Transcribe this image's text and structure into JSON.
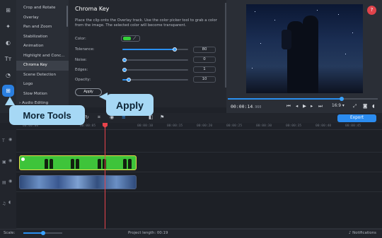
{
  "tools_list": {
    "items": [
      {
        "label": "Crop and Rotate"
      },
      {
        "label": "Overlay"
      },
      {
        "label": "Pan and Zoom"
      },
      {
        "label": "Stabilization"
      },
      {
        "label": "Animation"
      },
      {
        "label": "Highlight and Conc..."
      },
      {
        "label": "Chroma Key"
      },
      {
        "label": "Scene Detection"
      },
      {
        "label": "Logo"
      },
      {
        "label": "Slow Motion"
      }
    ],
    "selected": "Chroma Key",
    "folder": {
      "arrow": "›",
      "label": "Audio Editing"
    }
  },
  "panel": {
    "title": "Chroma Key",
    "description": "Place the clip onto the Overlay track. Use the color picker tool to grab a color from the image. The selected color will become transparent.",
    "color_label": "Color:",
    "key_color": "#35d13a",
    "tolerance": {
      "label": "Tolerance:",
      "value": "80",
      "level": 0.8
    },
    "noise": {
      "label": "Noise:",
      "value": "0",
      "level": 0.0
    },
    "edges": {
      "label": "Edges:",
      "value": "1",
      "level": 0.01
    },
    "opacity": {
      "label": "Opacity:",
      "value": "10",
      "level": 0.1
    },
    "apply_label": "Apply"
  },
  "callouts": {
    "more_tools": "More Tools",
    "apply": "Apply"
  },
  "player": {
    "timecode_main": "00:00:14",
    "timecode_ms": ".960",
    "aspect": "16:9 ▾",
    "progress": 0.76,
    "help": "?"
  },
  "timeline": {
    "export_label": "Export",
    "ruler_ticks": [
      "00:00:00",
      "00:00:05",
      "00:00:10",
      "00:00:15",
      "00:00:20",
      "00:00:25",
      "00:00:30",
      "00:00:35",
      "00:00:40",
      "00:00:45",
      "00:00:50",
      "00:00:55"
    ]
  },
  "status": {
    "scale_label": "Scale:",
    "scale_level": 0.5,
    "project_length": "Project length:  00:19",
    "notifications": "Notifications"
  },
  "colors": {
    "accent": "#2a8ff0",
    "callout": "#a6d8f5",
    "playhead": "#e8434b",
    "help": "#e0434b"
  }
}
